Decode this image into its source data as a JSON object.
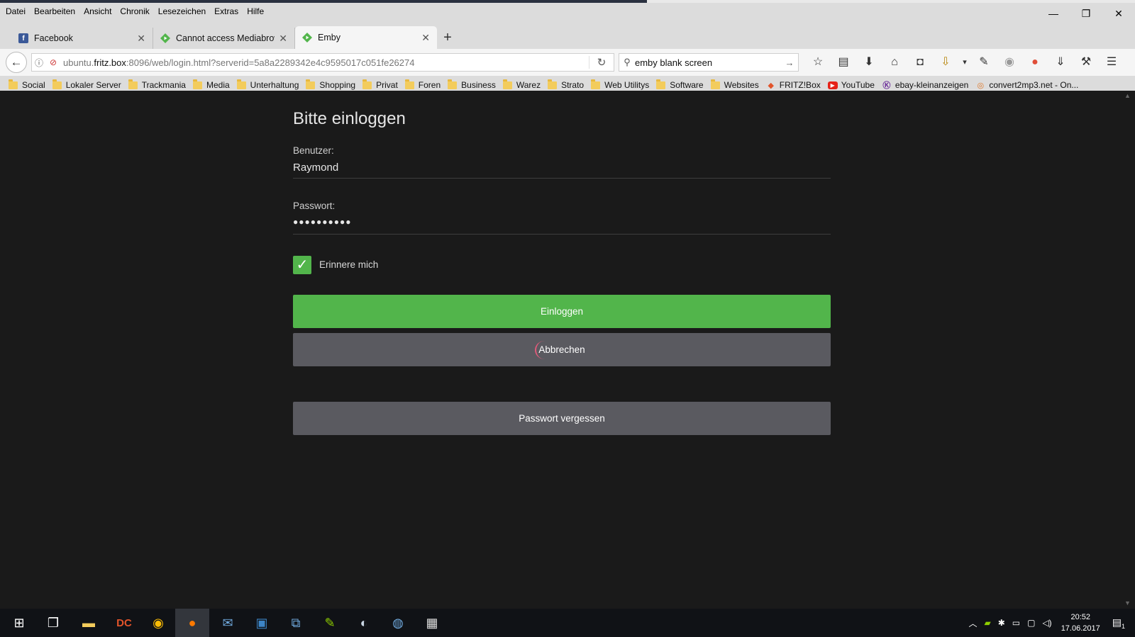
{
  "menubar": [
    "Datei",
    "Bearbeiten",
    "Ansicht",
    "Chronik",
    "Lesezeichen",
    "Extras",
    "Hilfe"
  ],
  "window_controls": {
    "minimize": "—",
    "restore": "❐",
    "close": "✕"
  },
  "tabs": [
    {
      "title": "Facebook",
      "icon": "facebook-icon",
      "active": false
    },
    {
      "title": "Cannot access Mediabrowse",
      "icon": "emby-icon",
      "active": false
    },
    {
      "title": "Emby",
      "icon": "emby-icon",
      "active": true
    }
  ],
  "navbar": {
    "url_prefix": "ubuntu.",
    "url_domain": "fritz.box",
    "url_rest": ":8096/web/login.html?serverid=5a8a2289342e4c9595017c051fe26274",
    "search_value": "emby blank screen"
  },
  "bookmarks": [
    {
      "label": "Social",
      "type": "folder"
    },
    {
      "label": "Lokaler Server",
      "type": "folder"
    },
    {
      "label": "Trackmania",
      "type": "folder"
    },
    {
      "label": "Media",
      "type": "folder"
    },
    {
      "label": "Unterhaltung",
      "type": "folder"
    },
    {
      "label": "Shopping",
      "type": "folder"
    },
    {
      "label": "Privat",
      "type": "folder"
    },
    {
      "label": "Foren",
      "type": "folder"
    },
    {
      "label": "Business",
      "type": "folder"
    },
    {
      "label": "Warez",
      "type": "folder"
    },
    {
      "label": "Strato",
      "type": "folder"
    },
    {
      "label": "Web Utilitys",
      "type": "folder"
    },
    {
      "label": "Software",
      "type": "folder"
    },
    {
      "label": "Websites",
      "type": "folder"
    },
    {
      "label": "FRITZ!Box",
      "type": "link"
    },
    {
      "label": "YouTube",
      "type": "link"
    },
    {
      "label": "ebay-kleinanzeigen",
      "type": "link"
    },
    {
      "label": "convert2mp3.net - On...",
      "type": "link"
    }
  ],
  "login": {
    "title": "Bitte einloggen",
    "user_label": "Benutzer:",
    "user_value": "Raymond",
    "password_label": "Passwort:",
    "password_value": "●●●●●●●●●●",
    "remember_label": "Erinnere mich",
    "remember_checked": true,
    "login_button": "Einloggen",
    "cancel_button": "Abbrechen",
    "forgot_button": "Passwort vergessen"
  },
  "taskbar": {
    "clock_time": "20:52",
    "clock_date": "17.06.2017",
    "notification_count": "1"
  },
  "colors": {
    "accent_green": "#52b54b",
    "button_gray": "#5a5a60",
    "page_bg": "#1a1a1a"
  }
}
